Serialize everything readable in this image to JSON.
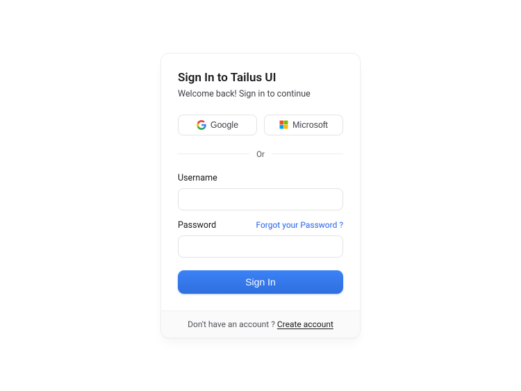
{
  "header": {
    "title": "Sign In to Tailus UI",
    "subtitle": "Welcome back! Sign in to continue"
  },
  "oauth": {
    "google_label": "Google",
    "microsoft_label": "Microsoft"
  },
  "separator": {
    "label": "Or"
  },
  "form": {
    "username_label": "Username",
    "password_label": "Password",
    "forgot_label": "Forgot your Password ?",
    "submit_label": "Sign In"
  },
  "footer": {
    "prompt": "Don't have an account ? ",
    "link_label": "Create account"
  }
}
